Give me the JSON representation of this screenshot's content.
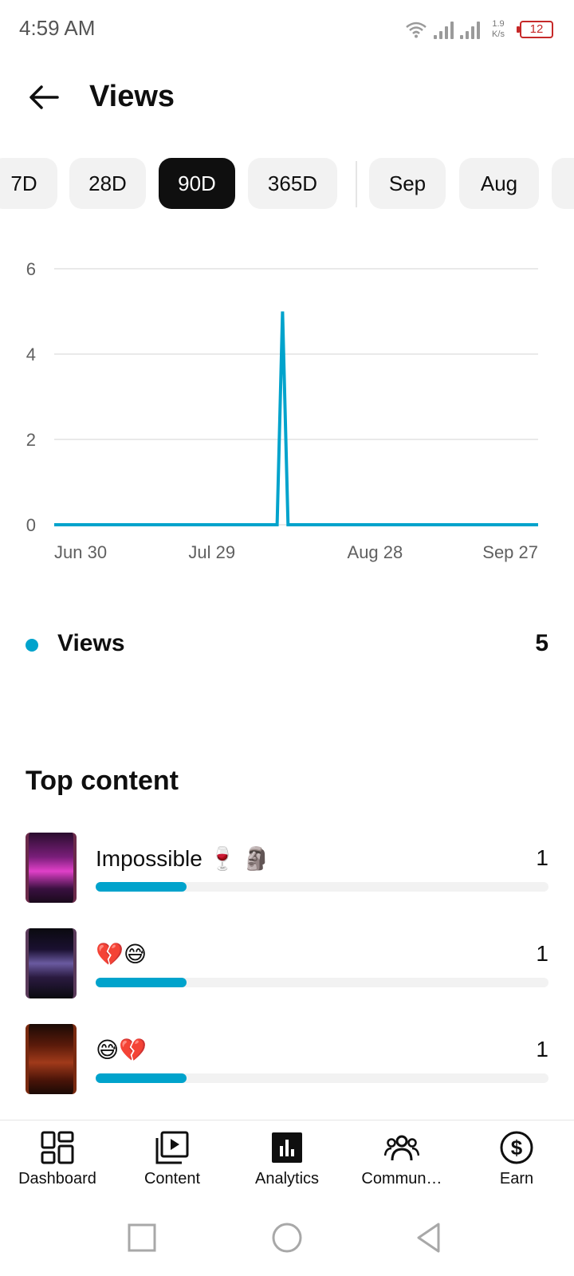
{
  "status_bar": {
    "time": "4:59 AM",
    "net_speed_value": "1.9",
    "net_speed_unit": "K/s",
    "battery": "12"
  },
  "header": {
    "title": "Views"
  },
  "chips": [
    {
      "label": "7D",
      "selected": false
    },
    {
      "label": "28D",
      "selected": false
    },
    {
      "label": "90D",
      "selected": true
    },
    {
      "label": "365D",
      "selected": false
    },
    {
      "label": "Sep",
      "selected": false
    },
    {
      "label": "Aug",
      "selected": false
    }
  ],
  "chart_data": {
    "type": "line",
    "series": [
      {
        "name": "Views",
        "x": [
          "2023-06-30",
          "2023-08-10",
          "2023-08-11",
          "2023-08-12",
          "2023-09-27"
        ],
        "values": [
          0,
          0,
          5,
          0,
          0
        ]
      }
    ],
    "x_ticks": [
      "Jun 30",
      "Jul 29",
      "Aug 28",
      "Sep 27"
    ],
    "y_ticks": [
      0,
      2,
      4,
      6
    ],
    "ylim": [
      0,
      6
    ],
    "grid": true,
    "color": "#00a3cc"
  },
  "legend": {
    "label": "Views",
    "total": "5"
  },
  "top_content": {
    "title": "Top content",
    "items": [
      {
        "title": "Impossible 🍷 🗿",
        "value": "1",
        "fraction": 0.2
      },
      {
        "title": "💔😅",
        "value": "1",
        "fraction": 0.2
      },
      {
        "title": "😅💔",
        "value": "1",
        "fraction": 0.2
      }
    ]
  },
  "bottom_nav": [
    {
      "label": "Dashboard",
      "icon": "dashboard-icon"
    },
    {
      "label": "Content",
      "icon": "content-icon"
    },
    {
      "label": "Analytics",
      "icon": "analytics-icon",
      "active": true
    },
    {
      "label": "Commun…",
      "icon": "community-icon"
    },
    {
      "label": "Earn",
      "icon": "earn-icon"
    }
  ]
}
